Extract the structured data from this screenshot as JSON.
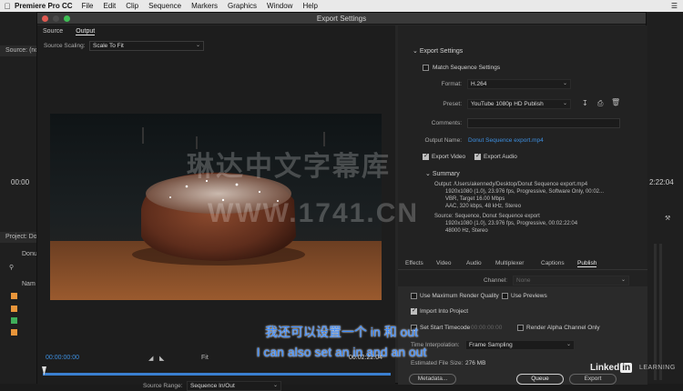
{
  "menubar": {
    "app_name": "Premiere Pro CC",
    "items": [
      "File",
      "Edit",
      "Clip",
      "Sequence",
      "Markers",
      "Graphics",
      "Window",
      "Help"
    ]
  },
  "background": {
    "source_label": "Source: (no",
    "timecode_left": "00:00",
    "project_label": "Project: Do",
    "project_item": "Donu",
    "name_header": "Nam",
    "timecode_right": "2:22:04"
  },
  "dialog": {
    "title": "Export Settings",
    "tabs": [
      "Source",
      "Output"
    ],
    "active_tab": "Output",
    "source_scaling_label": "Source Scaling:",
    "source_scaling_value": "Scale To Fit",
    "timeline": {
      "in_timecode": "00:00:00:00",
      "fit_label": "Fit",
      "out_timecode": "00:02:22:04",
      "source_range_label": "Source Range:",
      "source_range_value": "Sequence In/Out"
    },
    "export_settings": {
      "section_title": "Export Settings",
      "match_sequence_label": "Match Sequence Settings",
      "format_label": "Format:",
      "format_value": "H.264",
      "preset_label": "Preset:",
      "preset_value": "YouTube 1080p HD Publish",
      "comments_label": "Comments:",
      "output_name_label": "Output Name:",
      "output_name_value": "Donut Sequence export.mp4",
      "export_video_label": "Export Video",
      "export_audio_label": "Export Audio",
      "summary_title": "Summary",
      "summary_output_lines": [
        "Output: /Users/akennedy/Desktop/Donut Sequence export.mp4",
        "1920x1080 (1.0), 23.976 fps, Progressive, Software Only, 00:02...",
        "VBR, Target 16.00 Mbps",
        "AAC, 320 kbps, 48 kHz, Stereo"
      ],
      "summary_source_lines": [
        "Source: Sequence, Donut Sequence export",
        "1920x1080 (1.0), 23.976 fps, Progressive, 00:02:22:04",
        "48000 Hz, Stereo"
      ]
    },
    "settings_tabs": [
      "Effects",
      "Video",
      "Audio",
      "Multiplexer",
      "Captions",
      "Publish"
    ],
    "active_settings_tab": "Publish",
    "channel_label": "Channel:",
    "channel_value": "None",
    "options": {
      "max_render_quality": "Use Maximum Render Quality",
      "use_previews": "Use Previews",
      "import_into_project": "Import Into Project",
      "set_start_timecode": "Set Start Timecode",
      "start_timecode_value": "00:00:00:00",
      "render_alpha": "Render Alpha Channel Only",
      "interpolation_label": "Time Interpolation:",
      "interpolation_value": "Frame Sampling",
      "file_size_label": "Estimated File Size:",
      "file_size_value": "276 MB"
    },
    "buttons": {
      "metadata": "Metadata...",
      "queue": "Queue",
      "export": "Export"
    }
  },
  "overlay": {
    "subtitle_cn": "我还可以设置一个 in 和 out",
    "subtitle_en": "I can also set an in and an out",
    "watermark_cn": "琳达中文字幕库",
    "watermark_url": "WWW.1741.CN",
    "brand": "Linked",
    "brand_in": "in",
    "brand_learning": "LEARNING"
  },
  "colors": {
    "accent_blue": "#3d8fe0",
    "dialog_bg": "#262626",
    "menubar_bg": "#e9e9e9"
  }
}
